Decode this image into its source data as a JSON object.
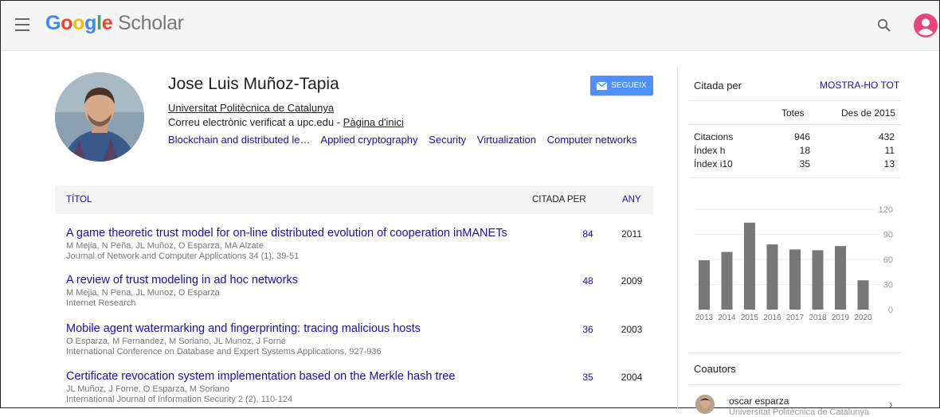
{
  "header": {
    "logo_google": "Google",
    "logo_scholar": "Scholar"
  },
  "profile": {
    "name": "Jose Luis Muñoz-Tapia",
    "affiliation": "Universitat Politècnica de Catalunya",
    "email_text": "Correu electrònic verificat a upc.edu",
    "email_separator": " - ",
    "homepage_link": "Pàgina d'inici",
    "interests": [
      "Blockchain and distributed le…",
      "Applied cryptography",
      "Security",
      "Virtualization",
      "Computer networks"
    ],
    "follow_label": "SEGUEIX"
  },
  "table": {
    "col_title": "TÍTOL",
    "col_cited": "CITADA PER",
    "col_year": "ANY",
    "rows": [
      {
        "title": "A game theoretic trust model for on-line distributed evolution of cooperation inMANETs",
        "authors": "M Mejia, N Peña, JL Muñoz, O Esparza, MA Alzate",
        "venue": "Journal of Network and Computer Applications 34 (1), 39-51",
        "cites": "84",
        "year": "2011"
      },
      {
        "title": "A review of trust modeling in ad hoc networks",
        "authors": "M Mejia, N Pena, JL Munoz, O Esparza",
        "venue": "Internet Research",
        "cites": "48",
        "year": "2009"
      },
      {
        "title": "Mobile agent watermarking and fingerprinting: tracing malicious hosts",
        "authors": "O Esparza, M Fernandez, M Soriano, JL Munoz, J Forné",
        "venue": "International Conference on Database and Expert Systems Applications, 927-936",
        "cites": "36",
        "year": "2003"
      },
      {
        "title": "Certificate revocation system implementation based on the Merkle hash tree",
        "authors": "JL Muñoz, J Forne, O Esparza, M Soriano",
        "venue": "International Journal of Information Security 2 (2), 110-124",
        "cites": "35",
        "year": "2004"
      }
    ]
  },
  "citations": {
    "title": "Citada per",
    "show_all": "MOSTRA-HO TOT",
    "col_all": "Totes",
    "col_since": "Des de 2015",
    "rows": [
      {
        "label": "Citacions",
        "all": "946",
        "since": "432"
      },
      {
        "label": "Índex h",
        "all": "18",
        "since": "11"
      },
      {
        "label": "Índex i10",
        "all": "35",
        "since": "13"
      }
    ]
  },
  "chart_data": {
    "type": "bar",
    "categories": [
      "2013",
      "2014",
      "2015",
      "2016",
      "2017",
      "2018",
      "2019",
      "2020"
    ],
    "values": [
      59,
      69,
      104,
      78,
      72,
      71,
      76,
      35
    ],
    "yticks": [
      "120",
      "90",
      "60",
      "30",
      "0"
    ],
    "ylim": [
      0,
      120
    ],
    "bar_color": "#777777"
  },
  "coauthors": {
    "title": "Coautors",
    "items": [
      {
        "name": "oscar esparza",
        "affiliation": "Universitat Politècnica de Catalunya"
      }
    ]
  },
  "colors": {
    "link": "#1a0dab",
    "follow_button": "#4d90fe",
    "avatar": "#e8457a"
  }
}
